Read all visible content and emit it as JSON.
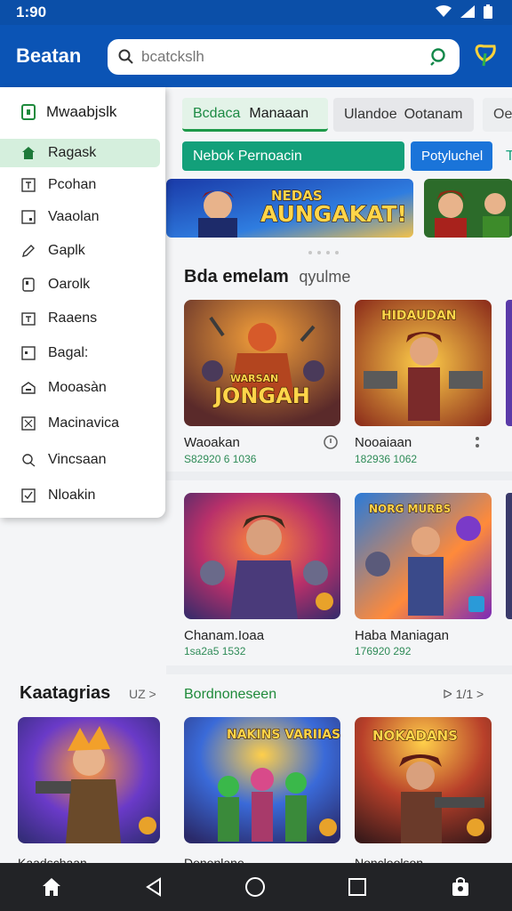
{
  "status": {
    "time": "1:90"
  },
  "app": {
    "brand": "Beatan",
    "search_placeholder": "bcatckslh"
  },
  "drawer": {
    "header": "Mwaabjslk",
    "items": [
      {
        "label": "Ragask",
        "icon": "home-icon",
        "active": true
      },
      {
        "label": "Pcohan",
        "icon": "t-box-icon"
      },
      {
        "label": "Vaaolan",
        "icon": "square-icon"
      },
      {
        "label": "Gaplk",
        "icon": "pencil-icon"
      },
      {
        "label": "Oarolk",
        "icon": "box-icon"
      },
      {
        "label": "Raaens",
        "icon": "calendar-icon"
      },
      {
        "label": "Bagal:",
        "icon": "grid-icon"
      },
      {
        "label": "Mooasàn",
        "icon": "house-icon"
      },
      {
        "label": "Macinavica",
        "icon": "puzzle-icon"
      },
      {
        "label": "Vincsaan",
        "icon": "tag-icon"
      },
      {
        "label": "Nloakin",
        "icon": "check-icon"
      }
    ]
  },
  "tabs": [
    {
      "label": "Bcdaca",
      "label2": "Manaaan"
    },
    {
      "label": "Ulandoe",
      "label2": "Ootanam"
    },
    {
      "label": "Oe"
    }
  ],
  "filters": [
    {
      "label": "Nebok Pernoacin"
    },
    {
      "label": "Potyluchel"
    },
    {
      "label": "T"
    }
  ],
  "banner": {
    "title_line1": "NEDAS",
    "title_line2": "AUNGAKAT!"
  },
  "section1": {
    "title": "Bda emelam",
    "subtitle": "qyulme"
  },
  "cards": [
    {
      "title": "Waoakan",
      "sub": "S82920 6 1036",
      "art": "JONGAH",
      "art_top": "WARSAN"
    },
    {
      "title": "Nooaiaan",
      "sub": "182936 1062",
      "art": "HIDAUDAN"
    },
    {
      "title": "Chanam.Ioaa",
      "sub": "1sa2a5 1532"
    },
    {
      "title": "Haba Maniagan",
      "sub": "176920 292",
      "art": "NORG MURBS"
    }
  ],
  "lower": {
    "category_title": "Kaatagrias",
    "category_more": "UZ >",
    "recommend_title": "Bordnoneseen",
    "recommend_more": "ᐅ 1/1 >",
    "cards": [
      {
        "title": "Kaadschaan"
      },
      {
        "title": "Denenlane",
        "art": "NAKINS VARIIAS"
      },
      {
        "title": "Noncleolson",
        "art": "NOKADANS"
      }
    ]
  },
  "colors": {
    "primary": "#0b54b5",
    "accent_green": "#13a07a",
    "active_nav": "#d5efdd"
  }
}
